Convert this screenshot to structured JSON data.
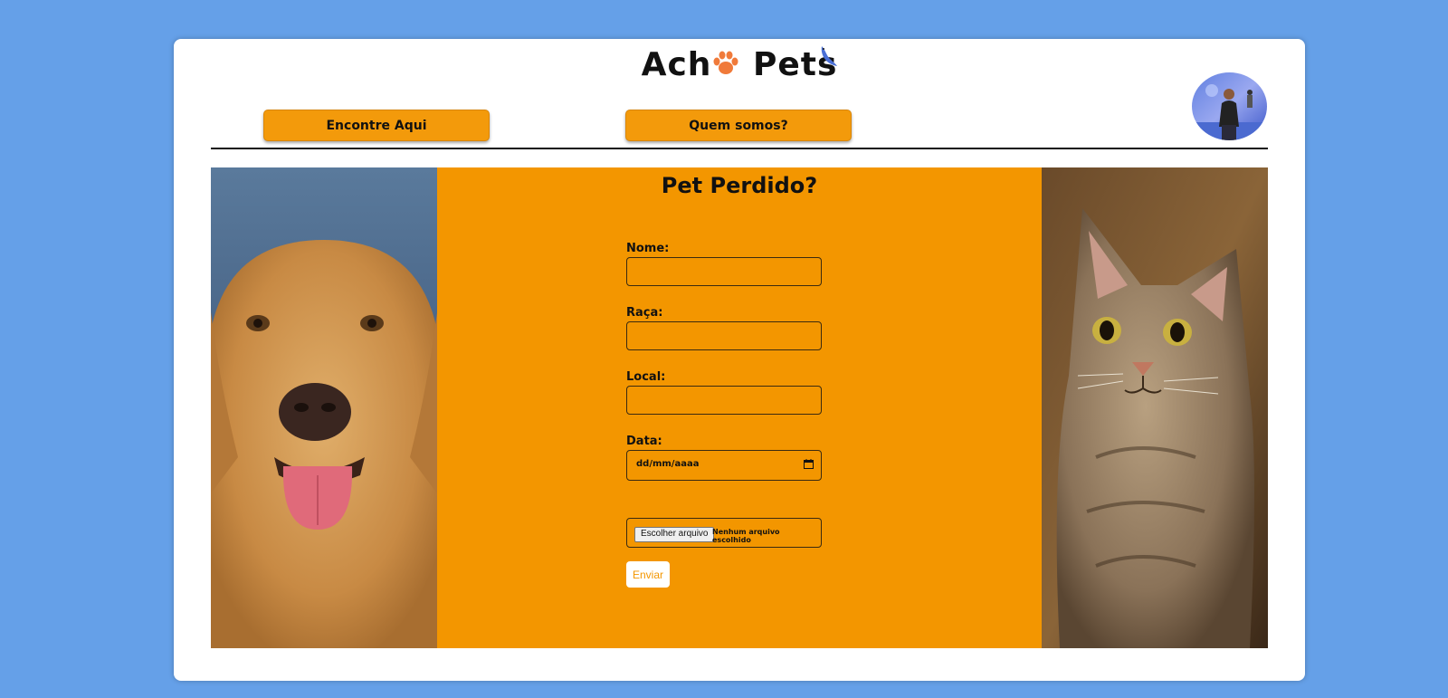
{
  "header": {
    "logo_text_left": "Ach",
    "logo_text_right": "Pets",
    "logo_paw_icon": "paw-icon",
    "logo_bird_icon": "bird-icon"
  },
  "nav": {
    "items": [
      {
        "label": "Encontre Aqui"
      },
      {
        "label": "Quem somos?"
      }
    ]
  },
  "form": {
    "title": "Pet Perdido?",
    "fields": [
      {
        "label": "Nome:",
        "value": ""
      },
      {
        "label": "Raça:",
        "value": ""
      },
      {
        "label": "Local:",
        "value": ""
      },
      {
        "label": "Data:",
        "placeholder": "dd/mm/aaaa"
      }
    ],
    "file": {
      "button_label": "Escolher arquivo",
      "status": "Nenhum arquivo escolhido"
    },
    "submit_label": "Enviar"
  },
  "colors": {
    "page_bg": "#65a0e8",
    "accent": "#f39600",
    "card_bg": "#ffffff"
  }
}
